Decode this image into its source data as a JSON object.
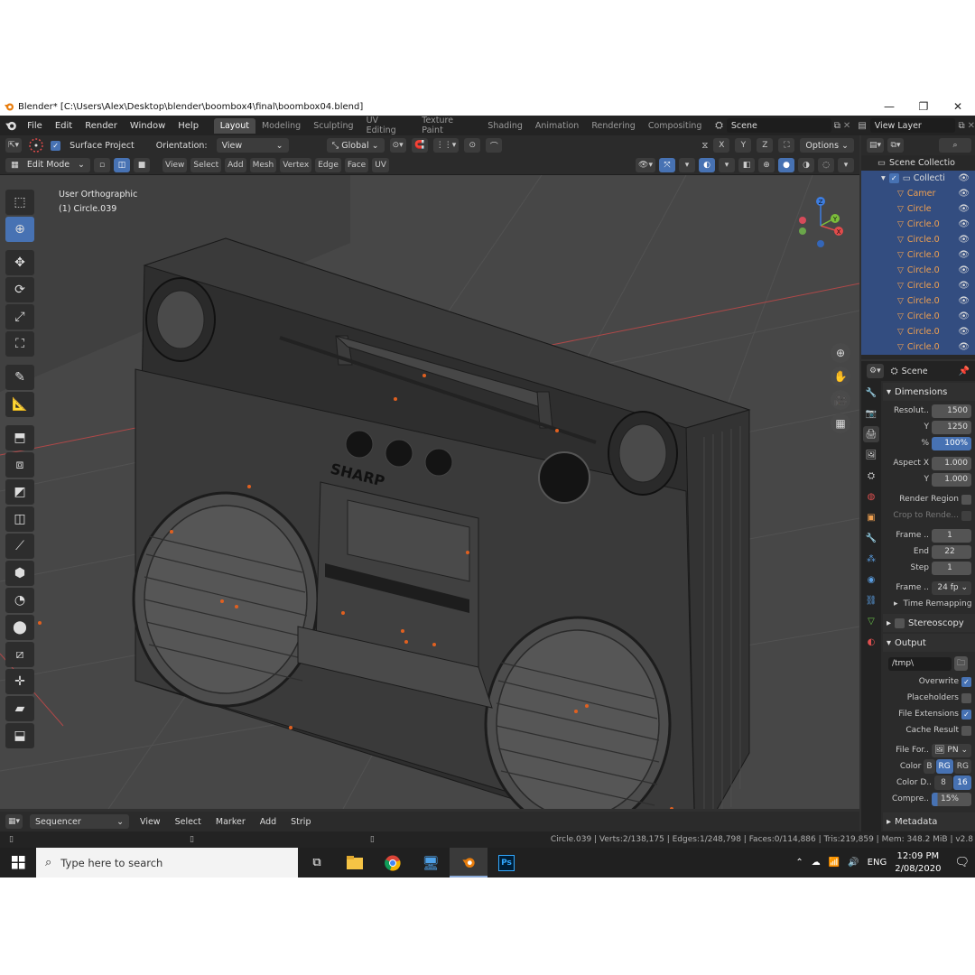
{
  "window": {
    "title": "Blender* [C:\\Users\\Alex\\Desktop\\blender\\boombox4\\final\\boombox04.blend]",
    "minimize": "—",
    "maximize": "❐",
    "close": "✕"
  },
  "topbar": {
    "menus": [
      "File",
      "Edit",
      "Render",
      "Window",
      "Help"
    ],
    "workspaces": [
      "Layout",
      "Modeling",
      "Sculpting",
      "UV Editing",
      "Texture Paint",
      "Shading",
      "Animation",
      "Rendering",
      "Compositing"
    ],
    "active_workspace": "Layout",
    "scene": "Scene",
    "view_layer": "View Layer"
  },
  "header1": {
    "surface_project": "Surface Project",
    "orientation_label": "Orientation:",
    "orientation_value": "View",
    "transform": "Global",
    "axes": [
      "X",
      "Y",
      "Z"
    ],
    "options": "Options"
  },
  "header2": {
    "mode": "Edit Mode",
    "menus": [
      "View",
      "Select",
      "Add",
      "Mesh",
      "Vertex",
      "Edge",
      "Face",
      "UV"
    ]
  },
  "viewport": {
    "view_name": "User Orthographic",
    "object_name": "(1) Circle.039",
    "gizmo_axes": [
      "X",
      "Y",
      "Z"
    ],
    "brand_text": "SHARP"
  },
  "sequencer": {
    "editor": "Sequencer",
    "menus": [
      "View",
      "Select",
      "Marker",
      "Add",
      "Strip"
    ]
  },
  "status": {
    "text": "Circle.039 | Verts:2/138,175 | Edges:1/248,798 | Faces:0/114,886 | Tris:219,859 | Mem: 348.2 MiB | v2.8"
  },
  "outliner": {
    "root": "Scene Collectio",
    "collection": "Collecti",
    "items": [
      "Camer",
      "Circle",
      "Circle.0",
      "Circle.0",
      "Circle.0",
      "Circle.0",
      "Circle.0",
      "Circle.0",
      "Circle.0",
      "Circle.0",
      "Circle.0"
    ]
  },
  "properties": {
    "scene": "Scene",
    "dimensions_title": "Dimensions",
    "resolution_x_label": "Resolut..",
    "resolution_x": "1500",
    "resolution_y_label": "Y",
    "resolution_y": "1250",
    "percent_label": "%",
    "percent": "100%",
    "aspect_x_label": "Aspect X",
    "aspect_x": "1.000",
    "aspect_y_label": "Y",
    "aspect_y": "1.000",
    "render_region": "Render Region",
    "crop": "Crop to Rende...",
    "frame_start_label": "Frame ..",
    "frame_start": "1",
    "frame_end_label": "End",
    "frame_end": "22",
    "frame_step_label": "Step",
    "frame_step": "1",
    "frame_rate_label": "Frame ..",
    "frame_rate": "24 fp",
    "time_remapping": "Time Remapping",
    "stereoscopy": "Stereoscopy",
    "output_title": "Output",
    "output_path": "/tmp\\",
    "overwrite": "Overwrite",
    "placeholders": "Placeholders",
    "file_extensions": "File Extensions",
    "cache_result": "Cache Result",
    "file_format_label": "File For..",
    "file_format": "PN",
    "color_label": "Color",
    "color_options": [
      "B",
      "RG",
      "RG"
    ],
    "color_depth_label": "Color D..",
    "color_depth_options": [
      "8",
      "16"
    ],
    "compression_label": "Compre..",
    "compression": "15%",
    "metadata": "Metadata"
  },
  "taskbar": {
    "search_placeholder": "Type here to search",
    "language": "ENG",
    "time": "12:09 PM",
    "date": "2/08/2020"
  },
  "colors": {
    "accent_blue": "#4772b3",
    "object_orange": "#f0a050",
    "x_axis": "#e14b4b",
    "y_axis": "#7bbd3a",
    "z_axis": "#3d7de0"
  }
}
